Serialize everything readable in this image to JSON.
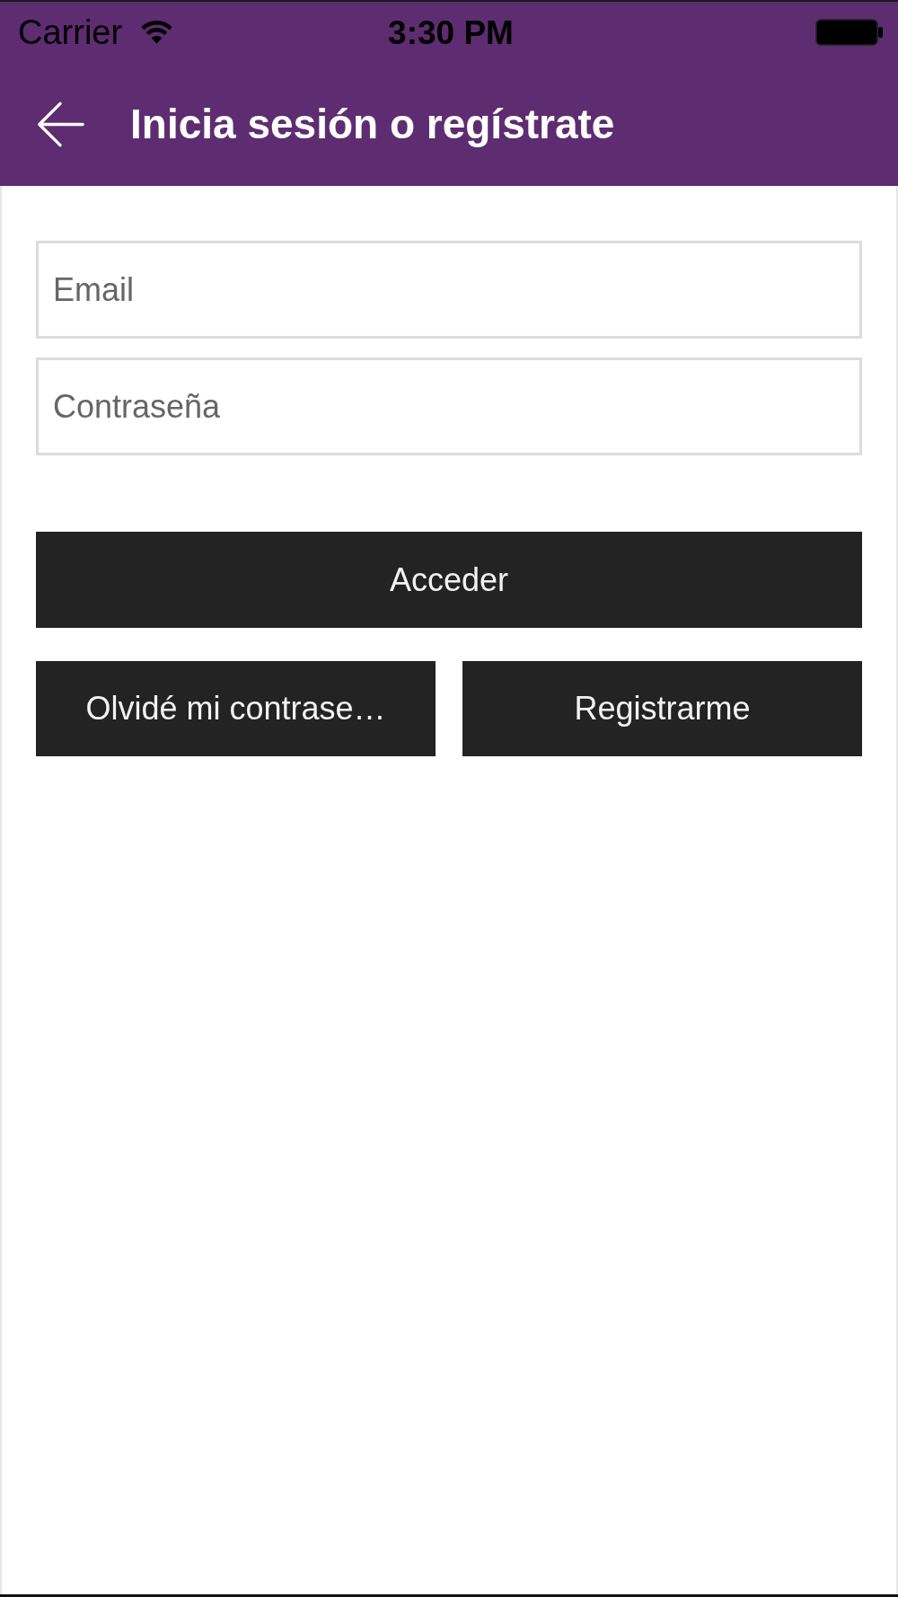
{
  "status_bar": {
    "carrier": "Carrier",
    "time": "3:30 PM"
  },
  "app_bar": {
    "title": "Inicia sesión o regístrate"
  },
  "form": {
    "email_field": {
      "placeholder": "Email"
    },
    "password_field": {
      "placeholder": "Contraseña"
    },
    "submit_button": "Acceder",
    "forgot_button": "Olvidé mi contrase…",
    "register_button": "Registrarme"
  }
}
